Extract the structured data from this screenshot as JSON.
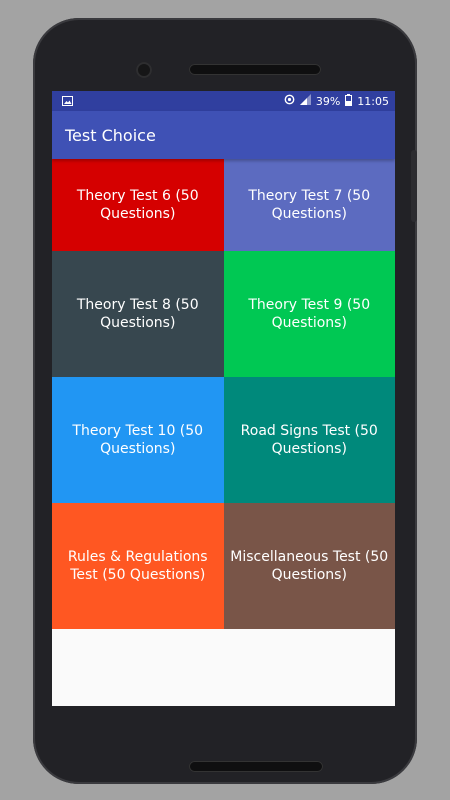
{
  "status_bar": {
    "battery": "39%",
    "time": "11:05",
    "icons": [
      "image-icon",
      "sync-icon",
      "signal-icon",
      "battery-icon"
    ]
  },
  "app_bar": {
    "title": "Test Choice",
    "color": "#3f51b5"
  },
  "tiles": [
    {
      "label": "Theory Test 6 (50 Questions)",
      "color": "#d50000"
    },
    {
      "label": "Theory Test 7 (50 Questions)",
      "color": "#5c6bc0"
    },
    {
      "label": "Theory Test 8 (50 Questions)",
      "color": "#37474f"
    },
    {
      "label": "Theory Test 9 (50 Questions)",
      "color": "#00c853"
    },
    {
      "label": "Theory Test 10 (50 Questions)",
      "color": "#2196f3"
    },
    {
      "label": "Road Signs Test (50 Questions)",
      "color": "#00897b"
    },
    {
      "label": "Rules & Regulations Test (50 Questions)",
      "color": "#ff5722"
    },
    {
      "label": "Miscellaneous Test (50 Questions)",
      "color": "#795548"
    }
  ]
}
